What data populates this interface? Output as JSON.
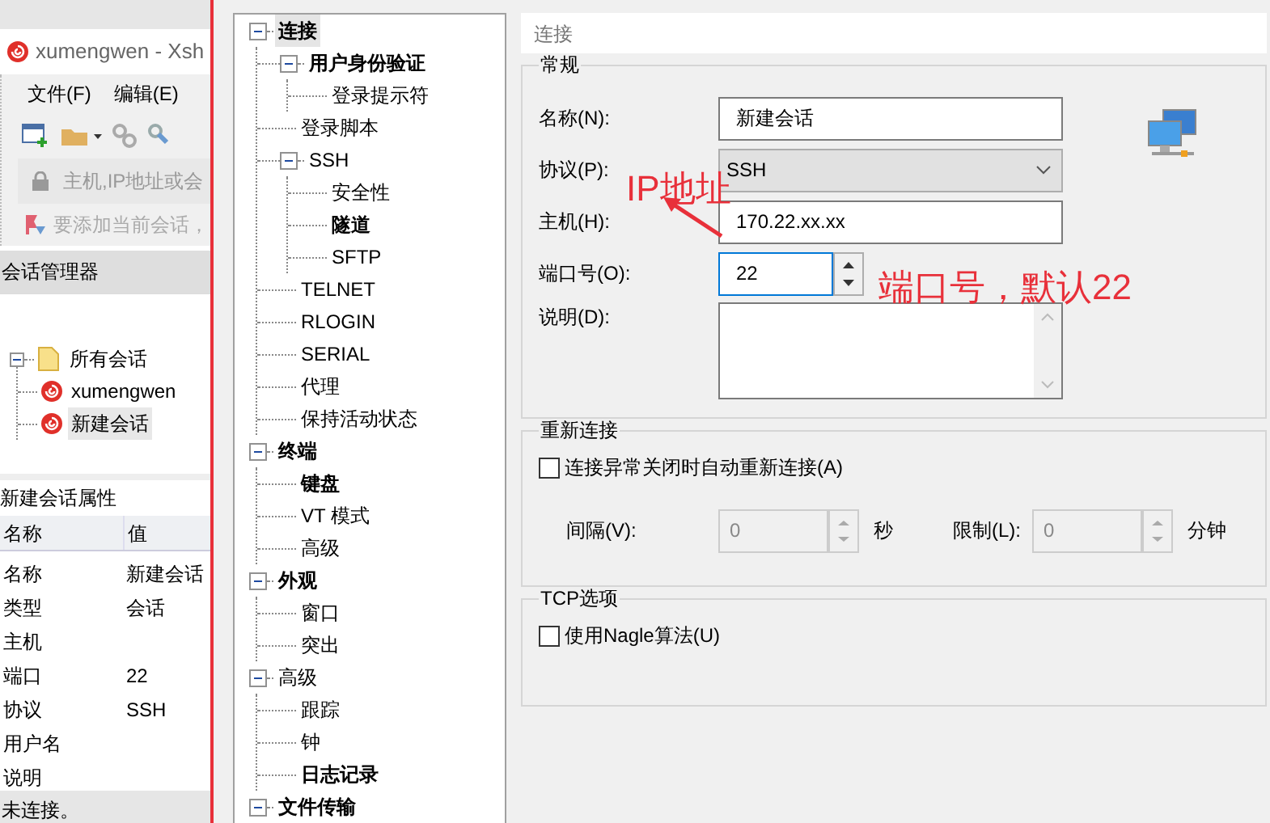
{
  "background_window": {
    "title": "xumengwen - Xsh",
    "menu": [
      "文件(F)",
      "编辑(E)"
    ],
    "address_placeholder": "主机,IP地址或会",
    "hint": "要添加当前会话，",
    "session_manager": {
      "title": "会话管理器",
      "tree": {
        "label": "所有会话",
        "expanded": true,
        "children": [
          {
            "label": "xumengwen",
            "selected": false
          },
          {
            "label": "新建会话",
            "selected": true
          }
        ]
      }
    },
    "properties": {
      "title": "新建会话属性",
      "columns": [
        "名称",
        "值"
      ],
      "rows": [
        {
          "name": "名称",
          "value": "新建会话"
        },
        {
          "name": "类型",
          "value": "会话"
        },
        {
          "name": "主机"
        },
        {
          "name": "端口",
          "value": "22"
        },
        {
          "name": "协议",
          "value": "SSH"
        },
        {
          "name": "用户名"
        },
        {
          "name": "说明"
        }
      ]
    },
    "status_bar": "未连接。"
  },
  "dialog": {
    "category_tree": [
      {
        "label": "连接",
        "bold": true,
        "selected": true,
        "expanded": true,
        "children": [
          {
            "label": "用户身份验证",
            "bold": true,
            "selected": false,
            "expanded": true,
            "children": [
              {
                "label": "登录提示符",
                "bold": false,
                "selected": false
              }
            ]
          },
          {
            "label": "登录脚本",
            "bold": false,
            "selected": false
          },
          {
            "label": "SSH",
            "bold": false,
            "selected": false,
            "expanded": true,
            "children": [
              {
                "label": "安全性",
                "bold": false,
                "selected": false
              },
              {
                "label": "隧道",
                "bold": true,
                "selected": false
              },
              {
                "label": "SFTP",
                "bold": false,
                "selected": false
              }
            ]
          },
          {
            "label": "TELNET",
            "bold": false,
            "selected": false
          },
          {
            "label": "RLOGIN",
            "bold": false,
            "selected": false
          },
          {
            "label": "SERIAL",
            "bold": false,
            "selected": false
          },
          {
            "label": "代理",
            "bold": false,
            "selected": false
          },
          {
            "label": "保持活动状态",
            "bold": false,
            "selected": false
          }
        ]
      },
      {
        "label": "终端",
        "bold": true,
        "selected": false,
        "expanded": true,
        "children": [
          {
            "label": "键盘",
            "bold": true,
            "selected": false
          },
          {
            "label": "VT 模式",
            "bold": false,
            "selected": false
          },
          {
            "label": "高级",
            "bold": false,
            "selected": false
          }
        ]
      },
      {
        "label": "外观",
        "bold": true,
        "selected": false,
        "expanded": true,
        "children": [
          {
            "label": "窗口",
            "bold": false,
            "selected": false
          },
          {
            "label": "突出",
            "bold": false,
            "selected": false
          }
        ]
      },
      {
        "label": "高级",
        "bold": false,
        "selected": false,
        "expanded": true,
        "children": [
          {
            "label": "跟踪",
            "bold": false,
            "selected": false
          },
          {
            "label": "钟",
            "bold": false,
            "selected": false
          },
          {
            "label": "日志记录",
            "bold": true,
            "selected": false
          }
        ]
      },
      {
        "label": "文件传输",
        "bold": true,
        "selected": false,
        "expanded": true
      }
    ],
    "page_title": "连接",
    "general": {
      "title": "常规",
      "fields": [
        {
          "kind": "text",
          "label": "名称(N):",
          "value": "新建会话"
        },
        {
          "kind": "select",
          "label": "协议(P):",
          "value": "SSH"
        },
        {
          "kind": "text",
          "label": "主机(H):",
          "value": "170.22.xx.xx"
        },
        {
          "kind": "spinner",
          "label": "端口号(O):",
          "value": "22",
          "focused": true
        },
        {
          "kind": "textarea",
          "label": "说明(D):"
        }
      ]
    },
    "reconnect": {
      "title": "重新连接",
      "checkbox": {
        "label": "连接异常关闭时自动重新连接(A)",
        "checked": false
      },
      "spinners": [
        {
          "label": "间隔(V):",
          "value": "0",
          "unit": "秒",
          "disabled": true
        },
        {
          "label": "限制(L):",
          "value": "0",
          "unit": "分钟",
          "disabled": true
        }
      ]
    },
    "tcp": {
      "title": "TCP选项",
      "checkbox": {
        "label": "使用Nagle算法(U)",
        "checked": false
      }
    }
  },
  "annotations": [
    {
      "kind": "arrow",
      "text": "IP地址"
    },
    {
      "kind": "plain",
      "text": "端口号，默认22"
    }
  ]
}
